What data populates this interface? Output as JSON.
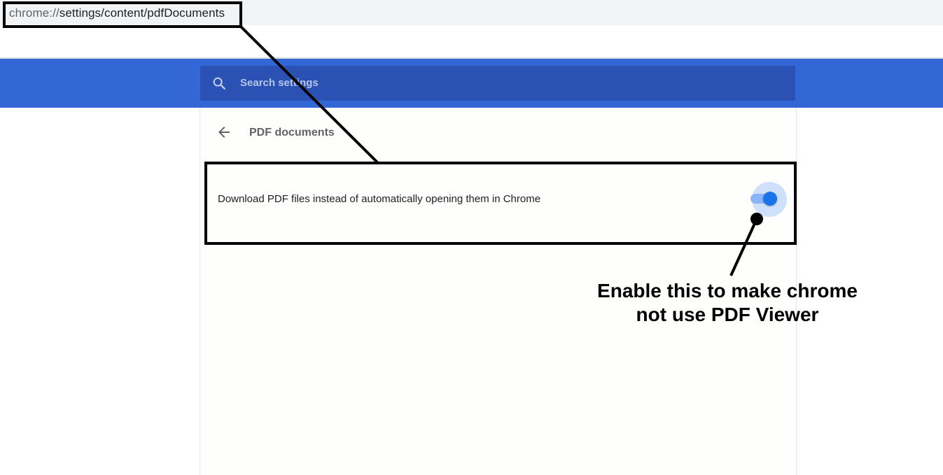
{
  "browser": {
    "url_scheme": "chrome://",
    "url_path": "settings/content/pdfDocuments"
  },
  "header": {
    "search_placeholder": "Search settings",
    "accent_color": "#3367d6"
  },
  "page": {
    "title": "PDF documents",
    "setting": {
      "label": "Download PDF files instead of automatically opening them in Chrome",
      "toggle_state": "on"
    }
  },
  "annotation": {
    "line1": "Enable this to make chrome",
    "line2": "not use PDF Viewer"
  },
  "icons": [
    "search-icon",
    "back-arrow-icon"
  ]
}
